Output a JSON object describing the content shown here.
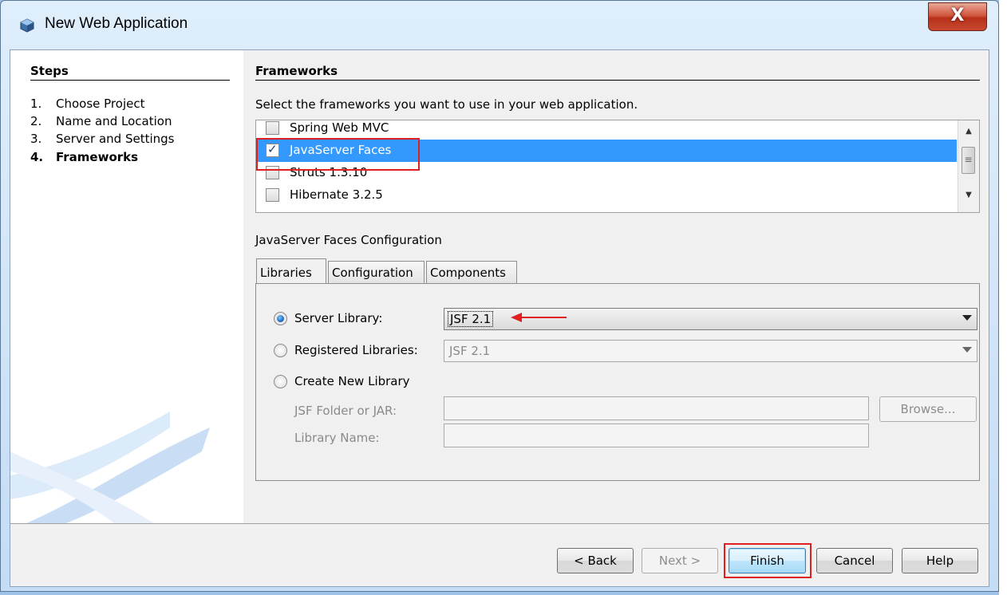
{
  "window": {
    "title": "New Web Application",
    "close_label": "X"
  },
  "steps": {
    "header": "Steps",
    "items": [
      {
        "num": "1.",
        "label": "Choose Project"
      },
      {
        "num": "2.",
        "label": "Name and Location"
      },
      {
        "num": "3.",
        "label": "Server and Settings"
      },
      {
        "num": "4.",
        "label": "Frameworks"
      }
    ]
  },
  "frameworks": {
    "header": "Frameworks",
    "description": "Select the frameworks you want to use in your web application.",
    "items": [
      {
        "label": "Spring Web MVC",
        "checked": false
      },
      {
        "label": "JavaServer Faces",
        "checked": true,
        "selected": true
      },
      {
        "label": "Struts 1.3.10",
        "checked": false
      },
      {
        "label": "Hibernate 3.2.5",
        "checked": false
      }
    ]
  },
  "config": {
    "label": "JavaServer Faces Configuration",
    "tabs": [
      "Libraries",
      "Configuration",
      "Components"
    ],
    "server_library": {
      "label": "Server Library:",
      "value": "JSF 2.1"
    },
    "registered_libraries": {
      "label": "Registered Libraries:",
      "value": "JSF 2.1"
    },
    "create_new_library": {
      "label": "Create New Library"
    },
    "jsf_folder": {
      "label": "JSF Folder or JAR:",
      "value": ""
    },
    "library_name": {
      "label": "Library Name:",
      "value": ""
    },
    "browse_label": "Browse..."
  },
  "footer": {
    "back": "< Back",
    "next": "Next >",
    "finish": "Finish",
    "cancel": "Cancel",
    "help": "Help"
  },
  "colors": {
    "selection": "#3399ff",
    "highlight_box": "#e02020",
    "accent_blue": "#1560b8"
  }
}
